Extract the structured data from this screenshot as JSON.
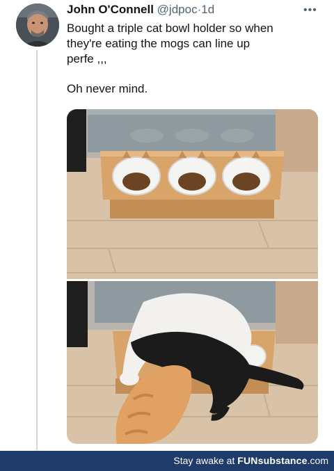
{
  "tweet": {
    "author_name": "John O'Connell",
    "handle": "@jdpoc",
    "separator": "·",
    "time": "1d",
    "more_icon": "more-icon",
    "text_line1": "Bought a triple cat bowl holder so when",
    "text_line2": "they're eating the mogs can line up",
    "text_line3": "perfe ,,,",
    "text_line4": "Oh never mind."
  },
  "footer": {
    "prefix": "Stay awake at ",
    "brand": "FUNsubstance",
    "suffix": ".com",
    "color": "#1f3b6a"
  }
}
